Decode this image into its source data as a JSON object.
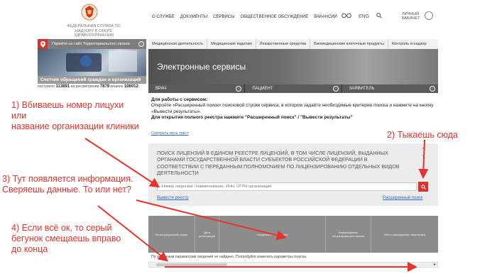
{
  "header": {
    "org_name": "Федеральная служба по надзору в сфере здравоохранения",
    "nav": [
      "О службе",
      "Документы",
      "Сервисы",
      "Общественное обсуждение",
      "Вакансии"
    ],
    "lang": "ENG",
    "cabinet": "Личный кабинет"
  },
  "territorial": {
    "label": "Перейти на сайт Территориального органа"
  },
  "categories": [
    "Медицинская деятельность",
    "Медицинские изделия",
    "Лекарственные средства",
    "Биомедицинские клеточные продукты",
    "Контроль и надзор"
  ],
  "counter": {
    "title": "Счетчик обращений граждан и организаций",
    "received_label": "поступило",
    "received": "113891",
    "pending_label": "на рассмотрении",
    "pending": "7879",
    "resolved_label": "решено",
    "resolved": "106012"
  },
  "banner": {
    "title": "Электронные сервисы"
  },
  "tabs": [
    "ВРАЧ",
    "ПАЦИЕНТ",
    "ЗАЯВИТЕЛЬ"
  ],
  "instructions": {
    "heading": "Для работы с сервисом:",
    "body": "Откройте «Расширенный поиск» поисковой строки сервиса, в котором задайте необходимые критерии поиска и нажмите на кнопку «Вывести результаты».",
    "bold": "Для открытия полного реестра нажмите \"Расширенный поиск\" / \"Вывести результаты\"",
    "see_all": "Смотреть весь текст"
  },
  "search": {
    "title": "Поиск лицензий в едином реестре лицензий, в том числе лицензий, выданных органами государственной власти субъектов Российской Федерации в соответствии с переданным полномочием по лицензированию отдельных видов деятельности",
    "placeholder": "Номер лицензии / Наименование, ИНН, ОГРН организации",
    "output_registry": "Вывести реестр",
    "advanced_search": "Расширенный поиск"
  },
  "table": {
    "columns": [
      "Регистрационный номер",
      "Дата регистрации",
      "Сведения о лицензиате",
      "Наименование лицензирующего органа",
      "Место нахождения лицензиата"
    ],
    "no_data": "По заданным параметрам сведений не найдено. Попробуйте изменить параметры поиска."
  },
  "annotations": {
    "a1_line1": "1) Вбиваешь номер лицухи",
    "a1_line2": "или",
    "a1_line3": "название организации клиники",
    "a2": "2) Тыкаешь сюда",
    "a3_line1": "3) Тут появляется информация.",
    "a3_line2": "Сверяешь данные. То или нет?",
    "a4_line1": "4) Если всё ок, то серый",
    "a4_line2": "бегунок смещаешь вправо",
    "a4_line3": "до конца"
  },
  "colors": {
    "accent_red": "#d9322a",
    "annotation_red": "#e8312a",
    "link_blue": "#2d6db4"
  }
}
